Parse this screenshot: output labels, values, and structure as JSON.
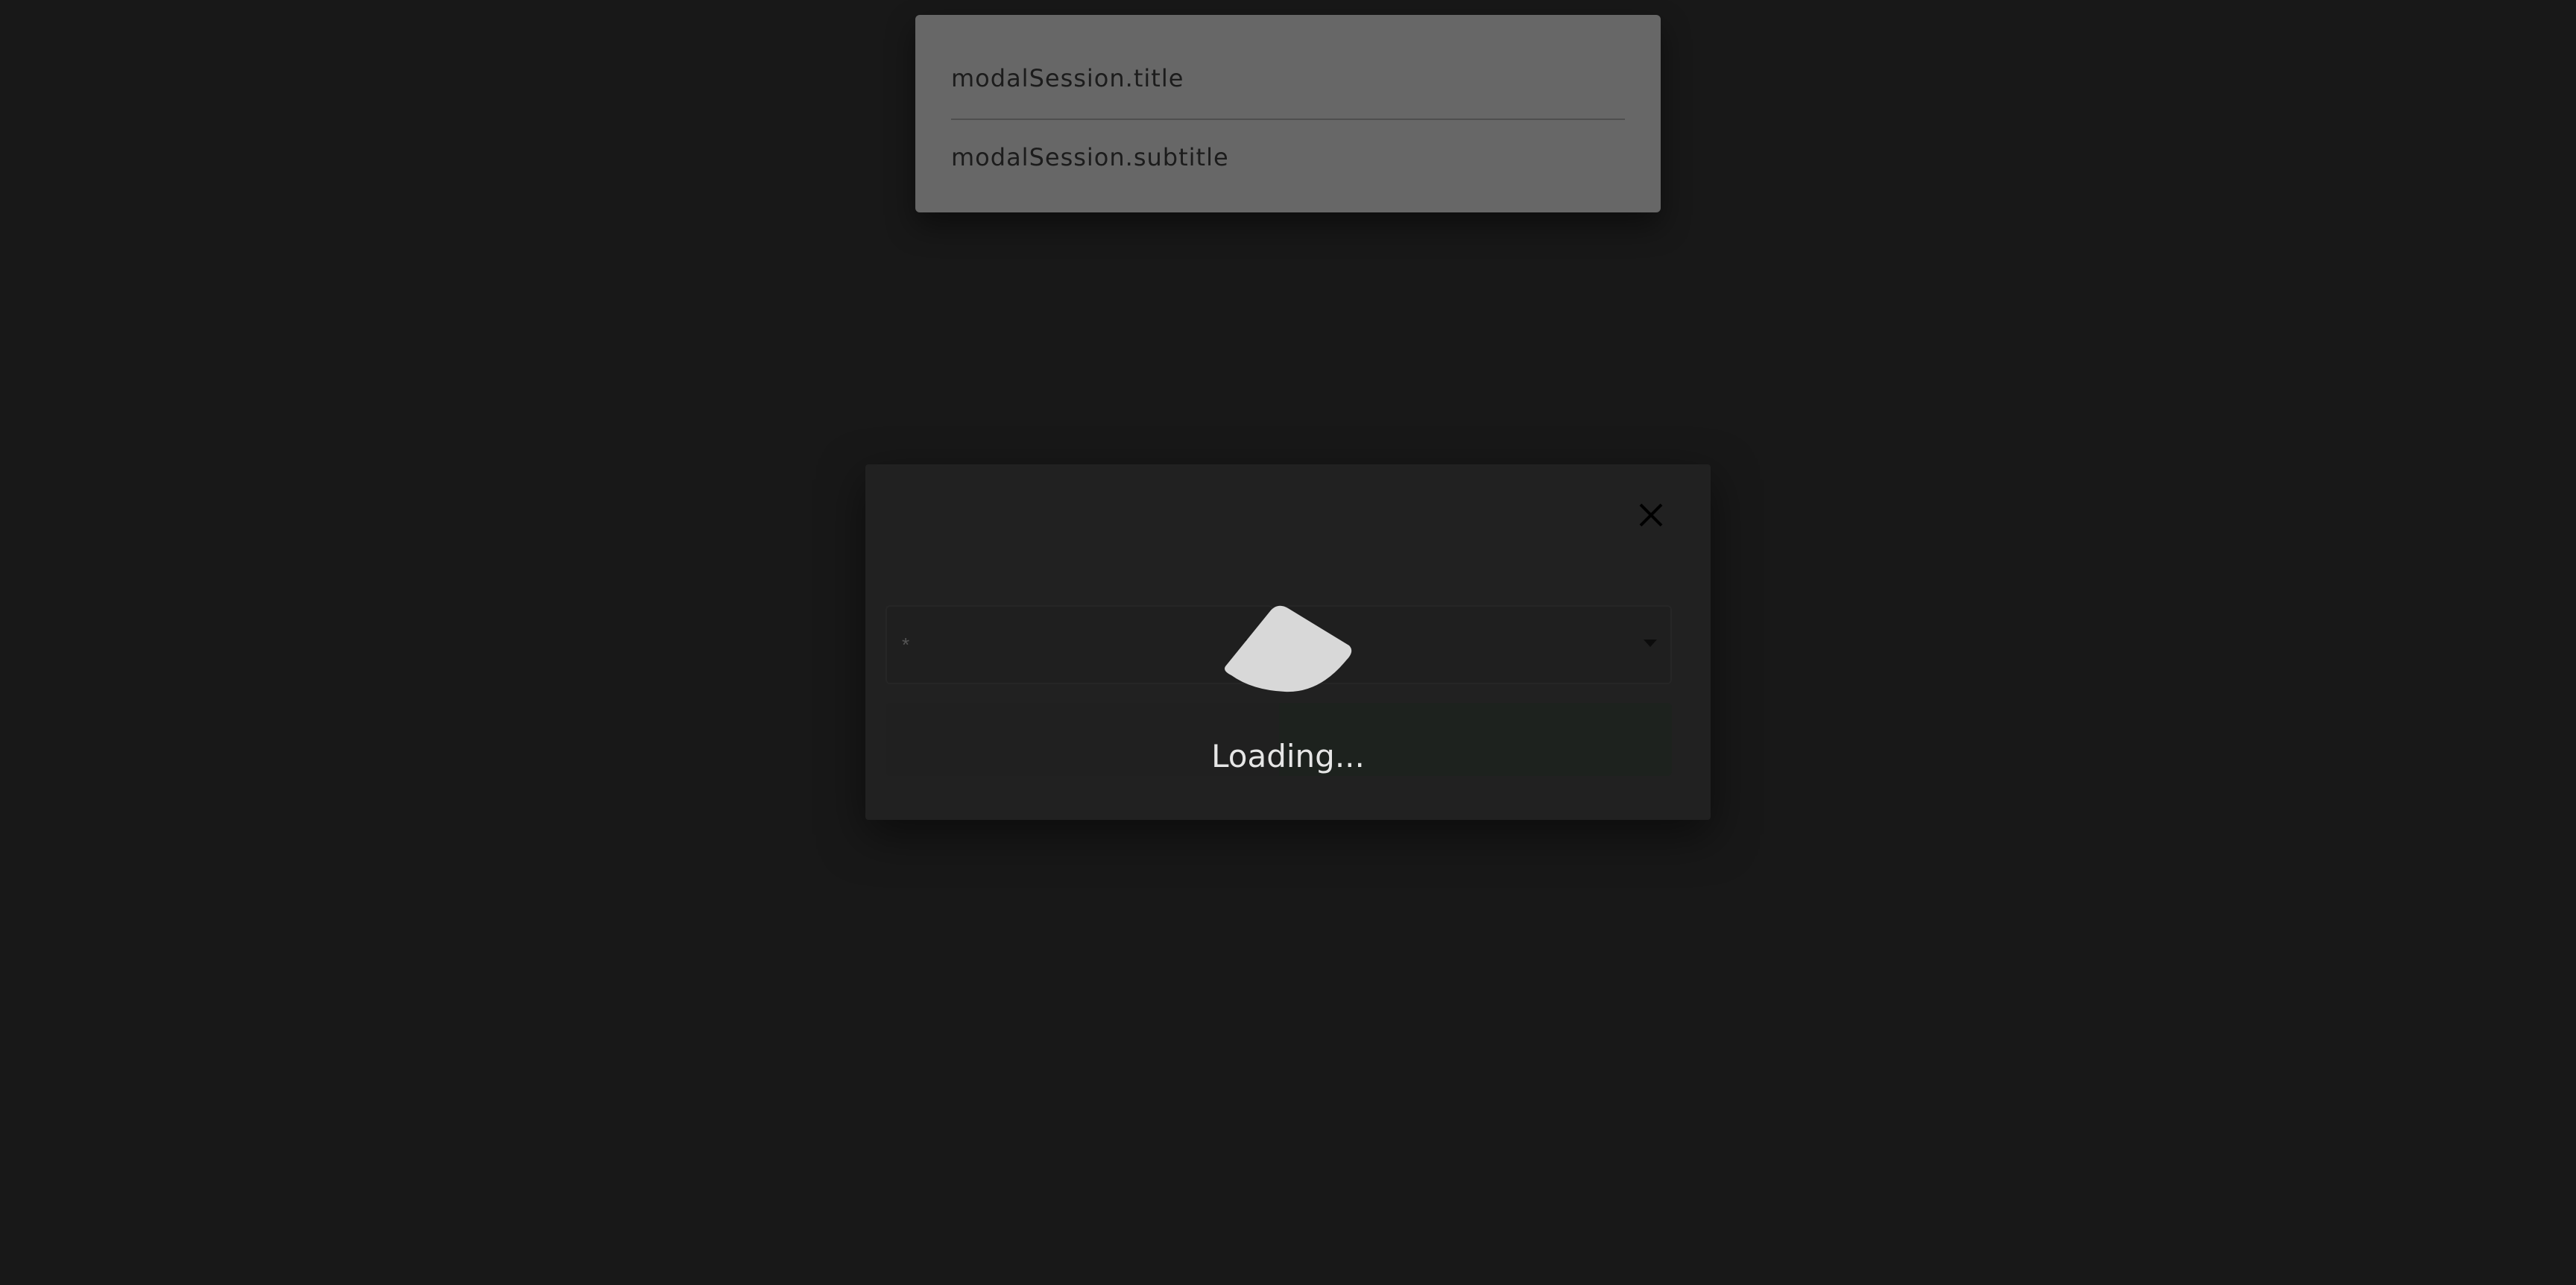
{
  "session": {
    "title": "modalSession.title",
    "subtitle": "modalSession.subtitle"
  },
  "modal": {
    "close_icon": "close-icon",
    "select_left_marker": "*",
    "select_right_marker": "",
    "caret_icon": "chevron-down-icon"
  },
  "loading": {
    "spinner_icon": "loading-spinner-icon",
    "text": "Loading..."
  },
  "colors": {
    "background": "#181818",
    "session_card": "#676767",
    "modal": "#212121",
    "loading_text": "#e6e6e6"
  }
}
